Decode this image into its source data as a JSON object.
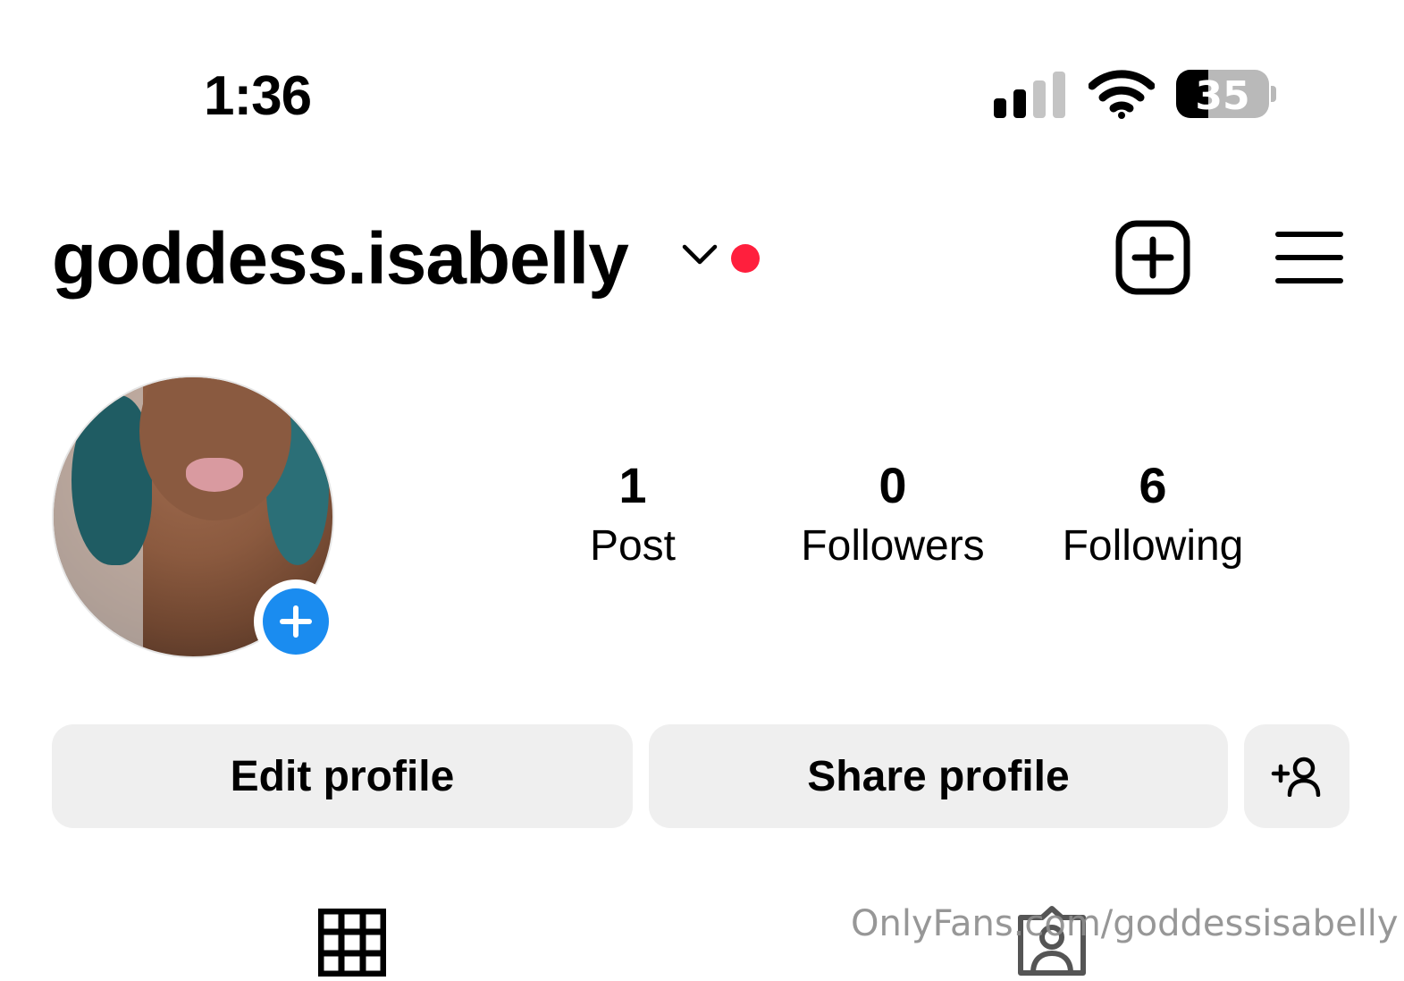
{
  "status_bar": {
    "time": "1:36",
    "battery": "35",
    "battery_fraction": 0.35,
    "icons": [
      "cellular-signal-icon",
      "wifi-icon",
      "battery-icon"
    ]
  },
  "header": {
    "username": "goddess.isabelly",
    "accent_dot_color": "#ff1f3d",
    "icons": [
      "chevron-down-icon",
      "create-plus-icon",
      "hamburger-menu-icon"
    ]
  },
  "profile": {
    "stats": [
      {
        "number": "1",
        "label": "Post"
      },
      {
        "number": "0",
        "label": "Followers"
      },
      {
        "number": "6",
        "label": "Following"
      }
    ],
    "add_story_color": "#1a8cf0"
  },
  "actions": {
    "edit_label": "Edit profile",
    "share_label": "Share profile"
  },
  "tabs": {
    "icons": [
      "grid-icon",
      "tagged-icon"
    ]
  },
  "watermark": "OnlyFans.com/goddessisabelly"
}
